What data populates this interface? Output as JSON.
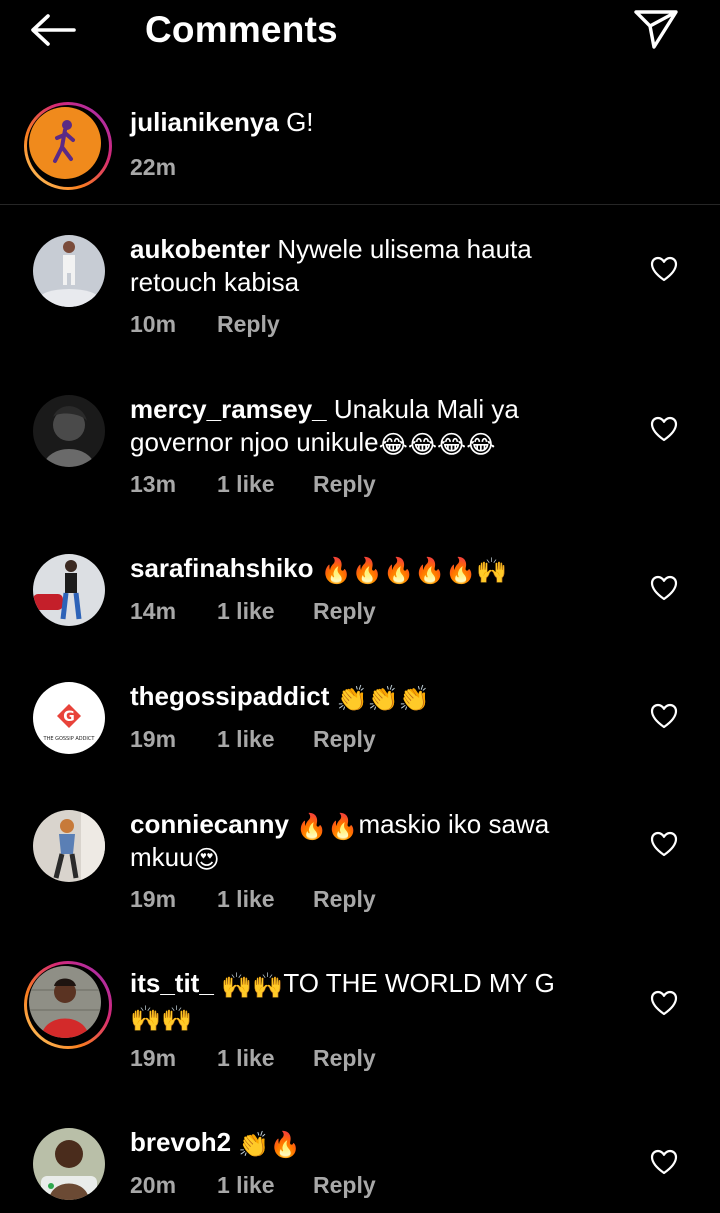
{
  "header": {
    "title": "Comments"
  },
  "caption": {
    "username": "julianikenya",
    "text": "G!",
    "time": "22m"
  },
  "comments": [
    {
      "username": "aukobenter",
      "text": "Nywele ulisema hauta retouch kabisa",
      "time": "10m",
      "likes": "",
      "reply": "Reply"
    },
    {
      "username": "mercy_ramsey_",
      "text": "Unakula Mali ya governor njoo unikule",
      "emoji": "😂😂😂😂",
      "time": "13m",
      "likes": "1 like",
      "reply": "Reply"
    },
    {
      "username": "sarafinahshiko",
      "text": "",
      "emoji": "🔥🔥🔥🔥🔥🙌",
      "time": "14m",
      "likes": "1 like",
      "reply": "Reply"
    },
    {
      "username": "thegossipaddict",
      "text": "",
      "emoji": "👏👏👏",
      "time": "19m",
      "likes": "1 like",
      "reply": "Reply",
      "avatar_text": "THE GOSSIP ADDICT",
      "avatar_letter": "G"
    },
    {
      "username": "conniecanny",
      "emoji": "🔥🔥",
      "text": "maskio iko sawa mkuu",
      "emoji_end": "😍",
      "time": "19m",
      "likes": "1 like",
      "reply": "Reply"
    },
    {
      "username": "its_tit_",
      "emoji": "🙌🙌",
      "text": "TO THE WORLD MY G",
      "emoji_end": "🙌🙌",
      "time": "19m",
      "likes": "1 like",
      "reply": "Reply"
    },
    {
      "username": "brevoh2",
      "text": "",
      "emoji": "👏🔥",
      "time": "20m",
      "likes": "1 like",
      "reply": "Reply"
    }
  ],
  "colors": {
    "background": "#000000",
    "text": "#ffffff",
    "secondary": "#a8a8a8",
    "divider": "#262626",
    "story_ring": "#d62976"
  },
  "icons": {
    "back": "arrow-left-icon",
    "share": "paper-plane-icon",
    "like": "heart-outline-icon"
  }
}
